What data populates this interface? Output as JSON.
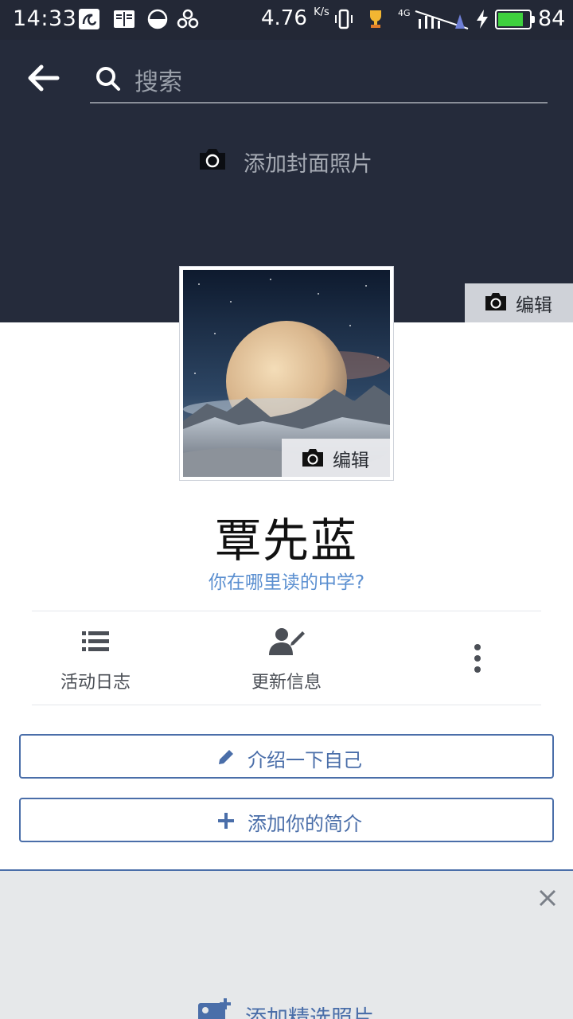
{
  "status_bar": {
    "time": "14:33",
    "net_speed": "4.76",
    "net_speed_unit": "K/s",
    "network": "4G",
    "battery_percent": "84",
    "battery_level": 0.84,
    "notification_icons": [
      "uc-browser-icon",
      "reader-icon",
      "half-circle-icon",
      "cloud-link-icon"
    ],
    "system_icons": [
      "vibrate-icon",
      "trophy-icon",
      "signal-icon",
      "charging-icon"
    ]
  },
  "header": {
    "search_placeholder": "搜索"
  },
  "cover": {
    "add_cover_label": "添加封面照片",
    "edit_label": "编辑",
    "background_color": "#252b3b"
  },
  "profile": {
    "avatar_edit_label": "编辑",
    "name": "覃先蓝",
    "school_prompt": "你在哪里读的中学?"
  },
  "actions": {
    "activity_log_label": "活动日志",
    "update_info_label": "更新信息"
  },
  "buttons": {
    "intro_label": "介绍一下自己",
    "bio_label": "添加你的简介"
  },
  "featured": {
    "add_featured_label": "添加精选照片"
  },
  "colors": {
    "accent": "#4a6ea9",
    "link": "#5b8fd0"
  }
}
